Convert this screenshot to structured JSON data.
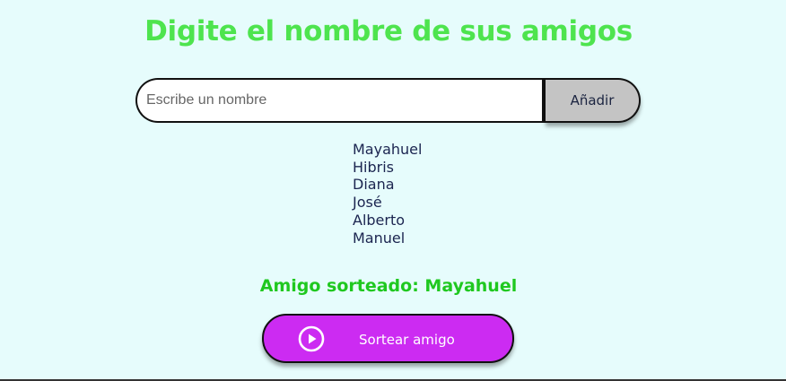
{
  "header": {
    "title": "Digite el nombre de sus amigos"
  },
  "form": {
    "input_placeholder": "Escribe un nombre",
    "input_value": "",
    "add_label": "Añadir"
  },
  "friends": [
    "Mayahuel",
    "Hibris",
    "Diana",
    "José",
    "Alberto",
    "Manuel"
  ],
  "result": {
    "text": "Amigo sorteado: Mayahuel"
  },
  "draw_button": {
    "label": "Sortear amigo",
    "icon": "play-circle-icon"
  },
  "colors": {
    "background": "#e6fcfc",
    "title": "#4ee44e",
    "result": "#1fc81f",
    "draw_button": "#cc2bf2",
    "add_button": "#c4c4c4",
    "list_text": "#1b2550"
  }
}
